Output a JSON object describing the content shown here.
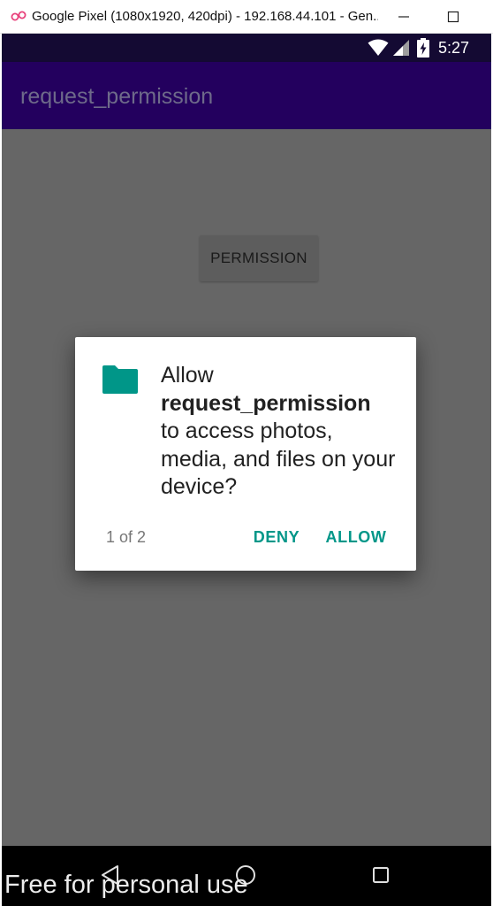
{
  "window": {
    "title": "Google Pixel (1080x1920, 420dpi) - 192.168.44.101 - Gen...",
    "logo_icon": "genymotion-logo-icon",
    "minimize_icon": "minimize-icon",
    "maximize_icon": "maximize-icon"
  },
  "statusbar": {
    "time": "5:27",
    "icons": [
      "wifi-icon",
      "signal-icon",
      "battery-icon"
    ]
  },
  "appbar": {
    "title": "request_permission"
  },
  "main": {
    "permission_button_label": "PERMISSION"
  },
  "dialog": {
    "icon": "folder-icon",
    "message_prefix": "Allow",
    "app_name": "request_permission",
    "message_suffix": "to access photos, media, and files on your device?",
    "counter": "1 of 2",
    "deny_label": "DENY",
    "allow_label": "ALLOW"
  },
  "navbar": {
    "icons": [
      "back-icon",
      "home-icon",
      "recents-icon"
    ]
  },
  "watermark": "Free for personal use",
  "colors": {
    "accent": "#009688",
    "appbar": "#23005e",
    "statusbar": "#140a33",
    "scrim_background": "#666666"
  }
}
